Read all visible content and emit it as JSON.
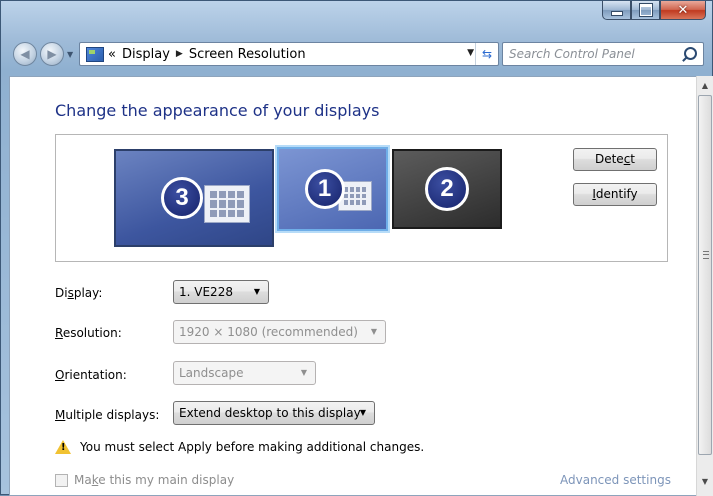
{
  "window": {
    "caption_buttons": {
      "minimize": "minimize-icon",
      "maximize": "maximize-icon",
      "close": "✕"
    }
  },
  "nav": {
    "back_icon": "arrow-left-icon",
    "forward_icon": "arrow-right-icon",
    "breadcrumb_prefix": "«",
    "breadcrumb": [
      "Display",
      "Screen Resolution"
    ],
    "search_placeholder": "Search Control Panel"
  },
  "page": {
    "title": "Change the appearance of your displays"
  },
  "monitors": [
    {
      "number": "3"
    },
    {
      "number": "1",
      "selected": true
    },
    {
      "number": "2"
    }
  ],
  "buttons": {
    "detect": "Detect",
    "identify": "Identify"
  },
  "settings": {
    "display_label": "Display:",
    "display_value": "1. VE228",
    "resolution_label": "Resolution:",
    "resolution_value": "1920 × 1080 (recommended)",
    "orientation_label": "Orientation:",
    "orientation_value": "Landscape",
    "multiple_label": "Multiple displays:",
    "multiple_value": "Extend desktop to this display"
  },
  "warning": {
    "text": "You must select Apply before making additional changes."
  },
  "footer": {
    "main_display_label": "Make this my main display",
    "main_display_checked": false,
    "advanced_link": "Advanced settings"
  },
  "colors": {
    "title_blue": "#1e3287",
    "link_blue": "#7d95b9",
    "selected_monitor_glow": "#6faee8"
  }
}
